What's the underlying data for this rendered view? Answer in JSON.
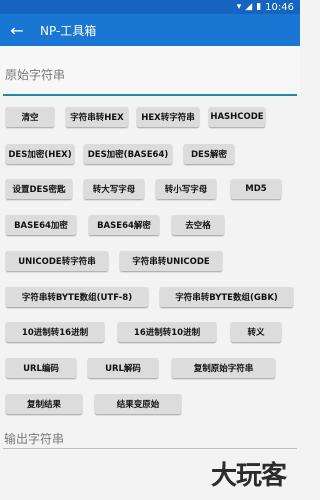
{
  "status_bar": {
    "time": "10:46",
    "icons": [
      "wifi-icon",
      "signal-icon",
      "battery-icon"
    ]
  },
  "app_bar": {
    "title": "NP-工具箱",
    "back_icon": "back-arrow-icon"
  },
  "input": {
    "placeholder": "原始字符串"
  },
  "buttons": [
    "清空",
    "字符串转HEX",
    "HEX转字符串",
    "HASHCODE",
    "DES加密(HEX)",
    "DES加密(BASE64)",
    "DES解密",
    "设置DES密匙",
    "转大写字母",
    "转小写字母",
    "MD5",
    "BASE64加密",
    "BASE64解密",
    "去空格",
    "UNICODE转字符串",
    "字符串转UNICODE",
    "字符串转BYTE数组(UTF-8)",
    "字符串转BYTE数组(GBK)",
    "10进制转16进制",
    "16进制转10进制",
    "转义",
    "URL编码",
    "URL解码",
    "复制原始字符串",
    "复制结果",
    "结果变原始"
  ],
  "output": {
    "placeholder": "输出字符串"
  },
  "watermark": "大玩客",
  "colors": {
    "status_bar": "#1565c0",
    "app_bar": "#1976d2",
    "accent_underline": "#1e88a8",
    "button_bg": "#dcdcdc"
  }
}
